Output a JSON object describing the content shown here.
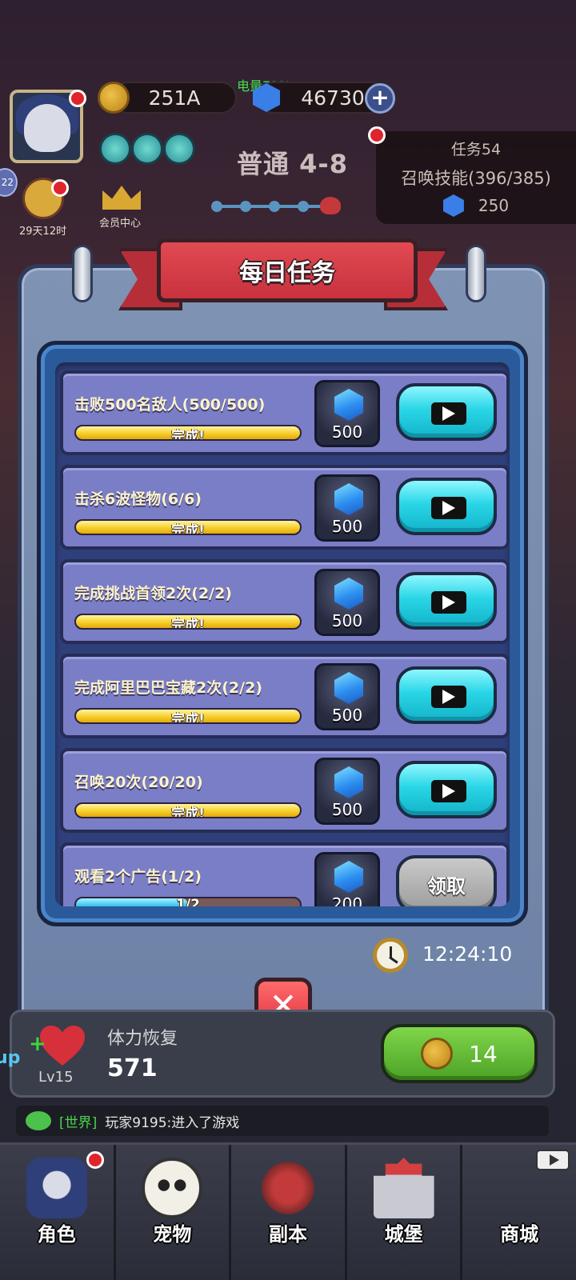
{
  "status_bar": {
    "battery": "电量71%"
  },
  "hud": {
    "gold": "251A",
    "gems": "46730",
    "stage": "普通 4-8",
    "left_badge": "22",
    "hero_timer": "29天12时",
    "vip_label": "会员中心",
    "side_label": "up"
  },
  "quest_card": {
    "title": "任务54",
    "desc": "召唤技能(396/385)",
    "reward": "250"
  },
  "modal": {
    "title": "每日任务",
    "tasks": [
      {
        "name": "击败500名敌人(500/500)",
        "bar_text": "完成!",
        "progress": 1.0,
        "reward": "500",
        "action": "video"
      },
      {
        "name": "击杀6波怪物(6/6)",
        "bar_text": "完成!",
        "progress": 1.0,
        "reward": "500",
        "action": "video"
      },
      {
        "name": "完成挑战首领2次(2/2)",
        "bar_text": "完成!",
        "progress": 1.0,
        "reward": "500",
        "action": "video"
      },
      {
        "name": "完成阿里巴巴宝藏2次(2/2)",
        "bar_text": "完成!",
        "progress": 1.0,
        "reward": "500",
        "action": "video"
      },
      {
        "name": "召唤20次(20/20)",
        "bar_text": "完成!",
        "progress": 1.0,
        "reward": "500",
        "action": "video"
      },
      {
        "name": "观看2个广告(1/2)",
        "bar_text": "1/2",
        "progress": 0.5,
        "reward": "200",
        "action": "claim",
        "action_label": "领取"
      }
    ],
    "reset_timer": "12:24:10"
  },
  "stamina": {
    "level": "Lv15",
    "title": "体力恢复",
    "value": "571",
    "buy_cost": "14"
  },
  "chat": {
    "channel": "[世界]",
    "message": "玩家9195:进入了游戏"
  },
  "nav": [
    {
      "label": "角色",
      "icon": "hero-icon"
    },
    {
      "label": "宠物",
      "icon": "pet-icon"
    },
    {
      "label": "副本",
      "icon": "dungeon-icon"
    },
    {
      "label": "城堡",
      "icon": "castle-icon"
    },
    {
      "label": "商城",
      "icon": "shop-icon"
    }
  ],
  "colors": {
    "panel": "#7f93b4",
    "ribbon": "#c8323d",
    "task_row": "#7a7ec6",
    "video_button": "#29d6e6",
    "progress_done": "#f7cf2a",
    "progress_partial": "#3bc8ef",
    "claim_button": "#9d9d9d"
  }
}
